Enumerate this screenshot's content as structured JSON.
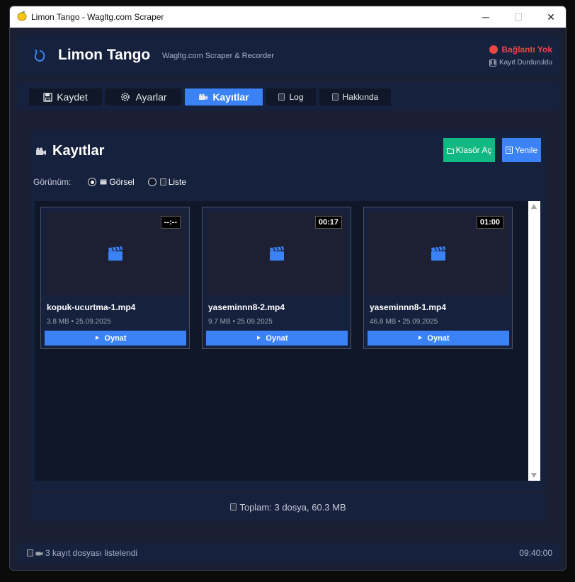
{
  "window": {
    "title": "Limon Tango - Wagltg.com Scraper",
    "minimize_glyph": "─",
    "maximize_glyph": "☐",
    "close_glyph": "✕"
  },
  "header": {
    "app_name": "Limon Tango",
    "subtitle": "Wagltg.com Scraper & Recorder",
    "connection_status": "Bağlantı Yok",
    "recording_status": "Kayıt Durduruldu",
    "status_color": "#ef4444"
  },
  "tabs": [
    {
      "label": "Kaydet",
      "icon": "floppy-disk-icon"
    },
    {
      "label": "Ayarlar",
      "icon": "gear-icon"
    },
    {
      "label": "Kayıtlar",
      "icon": "video-camera-icon",
      "active": true
    },
    {
      "label": "Log",
      "icon": "document-icon"
    },
    {
      "label": "Hakkında",
      "icon": "clipboard-icon"
    }
  ],
  "recordings": {
    "title": "Kayıtlar",
    "open_folder_label": "Klasör Aç",
    "refresh_label": "Yenile",
    "view_label": "Görünüm:",
    "view_options": [
      {
        "label": "Görsel",
        "selected": true
      },
      {
        "label": "Liste",
        "selected": false
      }
    ],
    "play_label": "Oynat",
    "items": [
      {
        "name": "kopuk-ucurtma-1.mp4",
        "meta": "3.8 MB • 25.09.2025",
        "duration": "--:--"
      },
      {
        "name": "yaseminnn8-2.mp4",
        "meta": "9.7 MB • 25.09.2025",
        "duration": "00:17"
      },
      {
        "name": "yaseminnn8-1.mp4",
        "meta": "46.8 MB • 25.09.2025",
        "duration": "01:00"
      }
    ]
  },
  "summary": {
    "text": "Toplam: 3 dosya, 60.3 MB"
  },
  "statusbar": {
    "message": "3 kayıt dosyası listelendi",
    "time": "09:40:00"
  },
  "colors": {
    "accent": "#3b82f6",
    "success": "#10b981",
    "background": "#1a1f33",
    "panel": "#16213e"
  }
}
